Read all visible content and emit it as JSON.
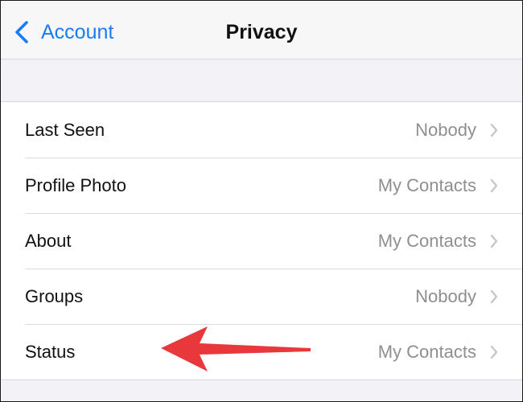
{
  "navbar": {
    "back_label": "Account",
    "title": "Privacy"
  },
  "rows": [
    {
      "label": "Last Seen",
      "value": "Nobody"
    },
    {
      "label": "Profile Photo",
      "value": "My Contacts"
    },
    {
      "label": "About",
      "value": "My Contacts"
    },
    {
      "label": "Groups",
      "value": "Nobody"
    },
    {
      "label": "Status",
      "value": "My Contacts"
    }
  ],
  "colors": {
    "accent": "#1a7cf5",
    "value_text": "#8e8e93",
    "annotation_arrow": "#e8383b",
    "background": "#f2f2f7"
  },
  "icons": {
    "back": "chevron-left-icon",
    "disclosure": "chevron-right-icon",
    "annotation": "red-arrow-icon"
  }
}
